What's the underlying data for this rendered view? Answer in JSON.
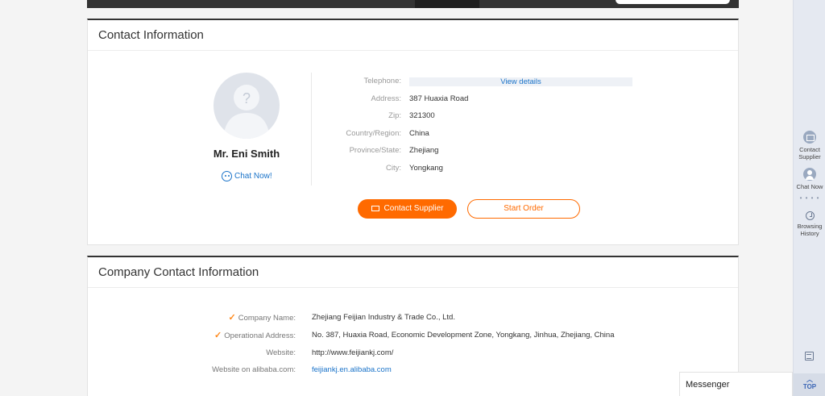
{
  "contact_card": {
    "title": "Contact Information",
    "person_name": "Mr. Eni Smith",
    "chat_now": "Chat Now!",
    "fields": [
      {
        "label": "Telephone:",
        "value": "View details"
      },
      {
        "label": "Address:",
        "value": "387 Huaxia Road"
      },
      {
        "label": "Zip:",
        "value": "321300"
      },
      {
        "label": "Country/Region:",
        "value": "China"
      },
      {
        "label": "Province/State:",
        "value": "Zhejiang"
      },
      {
        "label": "City:",
        "value": "Yongkang"
      }
    ],
    "contact_supplier_button": "Contact Supplier",
    "start_order_button": "Start Order"
  },
  "company_card": {
    "title": "Company Contact Information",
    "rows": [
      {
        "label": "Company Name:",
        "value": "Zhejiang Feijian Industry & Trade Co., Ltd.",
        "verified": true
      },
      {
        "label": "Operational Address:",
        "value": "No. 387, Huaxia Road, Economic Development Zone, Yongkang, Jinhua, Zhejiang, China",
        "verified": true
      },
      {
        "label": "Website:",
        "value": "http://www.feijiankj.com/"
      },
      {
        "label": "Website on alibaba.com:",
        "value": "feijiankj.en.alibaba.com"
      }
    ],
    "tick": "✓"
  },
  "sidebar": {
    "contact_supplier": [
      "Contact",
      "Supplier"
    ],
    "chat_now": "Chat Now",
    "browsing_history": [
      "Browsing",
      "History"
    ],
    "dots": "• • • •",
    "top": "TOP",
    "top_chevron": "︿"
  },
  "messenger": {
    "label": "Messenger"
  },
  "avatar_glyph": "?",
  "colors": {
    "accent": "#ff6a00",
    "link": "#1a73c9",
    "header_bar": "#333333"
  }
}
